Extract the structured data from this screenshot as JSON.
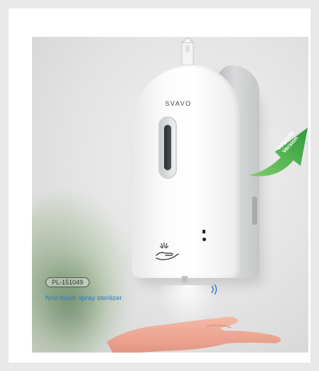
{
  "product": {
    "brand": "SVAVO",
    "model": "PL-151049",
    "caption": "Nno-touch spray sterilizer",
    "badge_line1": "Upgrade",
    "badge_line2": "Version"
  },
  "icons": {
    "hook": "hanging-hook-icon",
    "hand_spray": "hand-spray-icon",
    "sensor_wave": "sensor-wave-icon",
    "arrow": "upgrade-arrow-icon"
  },
  "colors": {
    "background": "#e9e9e9",
    "caption": "#2f78c4",
    "arrow": "#3aa34a"
  }
}
